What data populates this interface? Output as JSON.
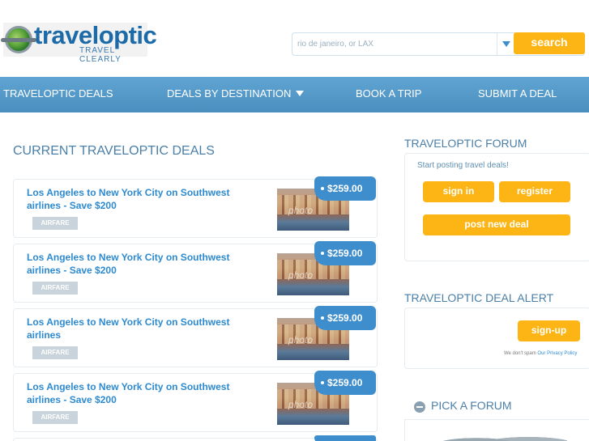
{
  "logo": {
    "name": "traveloptic",
    "tagline": "TRAVEL  CLEARLY"
  },
  "search": {
    "placeholder": "rio de janeiro, or LAX",
    "button": "search"
  },
  "nav": {
    "items": [
      "TRAVELOPTIC DEALS",
      "DEALS BY DESTINATION",
      "BOOK A TRIP",
      "SUBMIT A DEAL"
    ]
  },
  "main": {
    "title": "CURRENT TRAVELOPTIC DEALS",
    "deals": [
      {
        "title": "Los Angeles to New York City on Southwest airlines - Save $200",
        "tag": "AIRFARE",
        "price": "$259.00",
        "watermark": "photo"
      },
      {
        "title": "Los Angeles to New York City on Southwest airlines - Save $200",
        "tag": "AIRFARE",
        "price": "$259.00",
        "watermark": "photo"
      },
      {
        "title": "Los Angeles to New York City on Southwest airlines",
        "tag": "AIRFARE",
        "price": "$259.00",
        "watermark": "photo"
      },
      {
        "title": "Los Angeles to New York City on Southwest airlines - Save $200",
        "tag": "AIRFARE",
        "price": "$259.00",
        "watermark": "photo"
      }
    ]
  },
  "sidebar": {
    "forum": {
      "title": "TRAVELOPTIC FORUM",
      "text": "Start posting travel deals!",
      "signin": "sign in",
      "register": "register",
      "post": "post new deal"
    },
    "alert": {
      "title": "TRAVELOPTIC DEAL ALERT",
      "signup": "sign-up",
      "privacy_prefix": "We don't spam",
      "privacy_link": "Our Privacy Policy"
    },
    "pick": {
      "title": "PICK A FORUM"
    }
  },
  "colors": {
    "accent": "#fdb515",
    "nav": "#4b8fc0",
    "link": "#2d8ad0"
  }
}
